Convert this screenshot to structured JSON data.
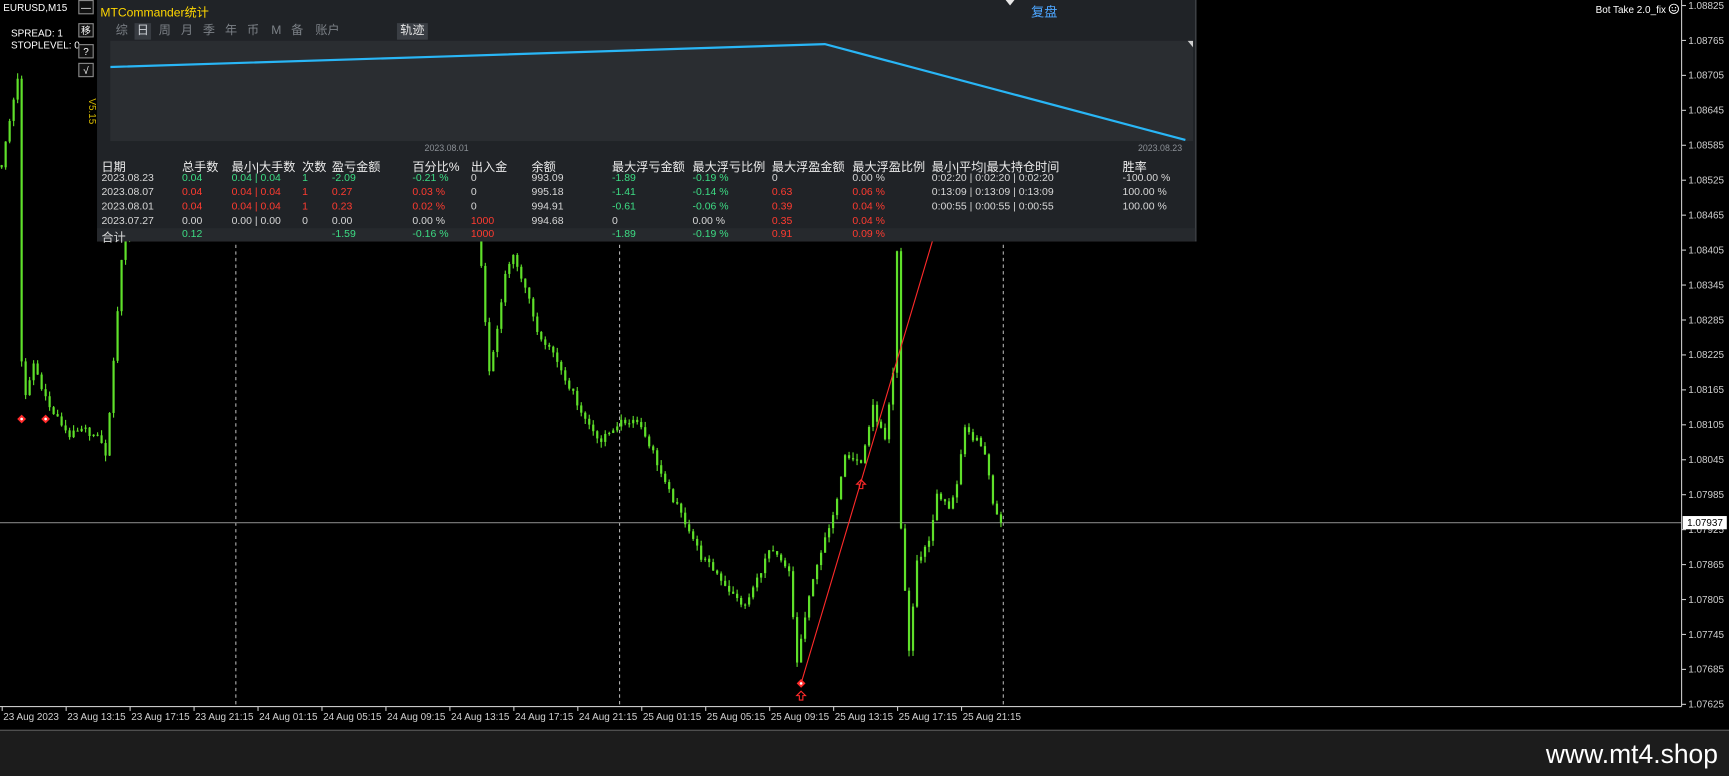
{
  "window": {
    "symbol_label": "EURUSD,M15",
    "spread": "SPREAD: 1",
    "stoplevel": "STOPLEVEL: 0",
    "version": "V5.15",
    "ea_name": "Bot Take 2.0_fix",
    "ea_icon": "smiley-icon",
    "watermark": "www.mt4.shop"
  },
  "side_buttons": {
    "minimize": "—",
    "move": "移",
    "help": "?",
    "check": "√"
  },
  "panel": {
    "title": "MTCommander统计",
    "replay": "复盘",
    "tabs": [
      "综",
      "日",
      "周",
      "月",
      "季",
      "年",
      "币",
      "M",
      "备",
      "账户"
    ],
    "active_tab": "日",
    "track_button": "轨迹",
    "track": {
      "date_labels": [
        "2023.08.01",
        "2023.08.23"
      ],
      "balance": [
        994.68,
        994.91,
        995.18,
        993.09
      ]
    },
    "table": {
      "headers": [
        "日期",
        "总手数",
        "最小|大手数",
        "次数",
        "盈亏金额",
        "百分比%",
        "出入金",
        "余额",
        "最大浮亏金额",
        "最大浮亏比例",
        "最大浮盈金额",
        "最大浮盈比例",
        "最小|平均|最大持仓时间",
        "胜率"
      ],
      "rows": [
        {
          "cells": [
            "2023.08.23",
            "0.04",
            "0.04 | 0.04",
            "1",
            "-2.09",
            "-0.21 %",
            "0",
            "993.09",
            "-1.89",
            "-0.19 %",
            "0",
            "0.00 %",
            "0:02:20 | 0:02:20 | 0:02:20",
            "-100.00 %"
          ],
          "tones": "wgggggwwggwwww"
        },
        {
          "cells": [
            "2023.08.07",
            "0.04",
            "0.04 | 0.04",
            "1",
            "0.27",
            "0.03 %",
            "0",
            "995.18",
            "-1.41",
            "-0.14 %",
            "0.63",
            "0.06 %",
            "0:13:09 | 0:13:09 | 0:13:09",
            "100.00 %"
          ],
          "tones": "wrrrrrwwggrrww"
        },
        {
          "cells": [
            "2023.08.01",
            "0.04",
            "0.04 | 0.04",
            "1",
            "0.23",
            "0.02 %",
            "0",
            "994.91",
            "-0.61",
            "-0.06 %",
            "0.39",
            "0.04 %",
            "0:00:55 | 0:00:55 | 0:00:55",
            "100.00 %"
          ],
          "tones": "wrrrrrwwggrrww"
        },
        {
          "cells": [
            "2023.07.27",
            "0.00",
            "0.00 | 0.00",
            "0",
            "0.00",
            "0.00 %",
            "1000",
            "994.68",
            "0",
            "0.00 %",
            "0.35",
            "0.04 %",
            "",
            ""
          ],
          "tones": "wwwwwwrwwwrrww"
        },
        {
          "cells": [
            "合计",
            "0.12",
            "",
            "",
            "-1.59",
            "-0.16 %",
            "1000",
            "",
            "-1.89",
            "-0.19 %",
            "0.91",
            "0.09 %",
            "",
            ""
          ],
          "tones": "wgwwggrwggrrww"
        }
      ]
    }
  },
  "colors": {
    "green": "#3ddc84",
    "red": "#ff3b30",
    "white": "#d6d6d6",
    "candle": "#5fe02a",
    "track_line": "#29b6f6",
    "trade": "#ff2a2a",
    "axis_text": "#d0d0d0",
    "price_line": "#808080",
    "separator": "#b0b0b0"
  },
  "chart_data": {
    "type": "candlestick",
    "symbol": "EURUSD",
    "timeframe": "M15",
    "price_labels": [
      "1.08825",
      "1.08765",
      "1.08705",
      "1.08645",
      "1.08585",
      "1.08525",
      "1.08465",
      "1.08405",
      "1.08345",
      "1.08285",
      "1.08225",
      "1.08165",
      "1.08105",
      "1.08045",
      "1.07985",
      "1.07925",
      "1.07865",
      "1.07805",
      "1.07745",
      "1.07685",
      "1.07625"
    ],
    "current_price": "1.07937",
    "time_labels": [
      "23 Aug 2023",
      "23 Aug 13:15",
      "23 Aug 17:15",
      "23 Aug 21:15",
      "24 Aug 01:15",
      "24 Aug 05:15",
      "24 Aug 09:15",
      "24 Aug 13:15",
      "24 Aug 17:15",
      "24 Aug 21:15",
      "25 Aug 01:15",
      "25 Aug 05:15",
      "25 Aug 09:15",
      "25 Aug 13:15",
      "25 Aug 17:15",
      "25 Aug 21:15"
    ],
    "day_separators": [
      "24 Aug 00:00",
      "25 Aug 00:00",
      "26 Aug 00:00"
    ],
    "close_path": [
      {
        "t": "23 Aug 09:15",
        "p": 1.08551
      },
      {
        "t": "23 Aug 09:45",
        "p": 1.08626
      },
      {
        "t": "23 Aug 10:15",
        "p": 1.08702
      },
      {
        "t": "23 Aug 10:30",
        "p": 1.0821
      },
      {
        "t": "23 Aug 10:45",
        "p": 1.08153
      },
      {
        "t": "23 Aug 11:15",
        "p": 1.0821
      },
      {
        "t": "23 Aug 12:15",
        "p": 1.08134
      },
      {
        "t": "23 Aug 13:30",
        "p": 1.08087
      },
      {
        "t": "23 Aug 14:30",
        "p": 1.08096
      },
      {
        "t": "23 Aug 15:30",
        "p": 1.08077
      },
      {
        "t": "23 Aug 15:45",
        "p": 1.08049
      },
      {
        "t": "23 Aug 16:15",
        "p": 1.0821
      },
      {
        "t": "23 Aug 16:30",
        "p": 1.08304
      },
      {
        "t": "23 Aug 16:45",
        "p": 1.0839
      },
      {
        "t": "23 Aug 17:15",
        "p": 1.08456
      },
      {
        "t": "23 Aug 21:45",
        "p": 1.0856
      },
      {
        "t": "24 Aug 02:45",
        "p": 1.086
      },
      {
        "t": "24 Aug 07:45",
        "p": 1.0854
      },
      {
        "t": "24 Aug 12:45",
        "p": 1.0852
      },
      {
        "t": "24 Aug 15:00",
        "p": 1.08456
      },
      {
        "t": "24 Aug 15:15",
        "p": 1.0838
      },
      {
        "t": "24 Aug 15:45",
        "p": 1.08191
      },
      {
        "t": "24 Aug 16:15",
        "p": 1.08267
      },
      {
        "t": "24 Aug 16:45",
        "p": 1.08361
      },
      {
        "t": "24 Aug 17:15",
        "p": 1.08399
      },
      {
        "t": "24 Aug 18:00",
        "p": 1.08342
      },
      {
        "t": "24 Aug 18:45",
        "p": 1.08267
      },
      {
        "t": "24 Aug 19:45",
        "p": 1.08229
      },
      {
        "t": "24 Aug 20:45",
        "p": 1.08172
      },
      {
        "t": "24 Aug 21:45",
        "p": 1.08115
      },
      {
        "t": "24 Aug 22:45",
        "p": 1.08077
      },
      {
        "t": "24 Aug 23:45",
        "p": 1.08106
      },
      {
        "t": "25 Aug 01:00",
        "p": 1.08115
      },
      {
        "t": "25 Aug 02:00",
        "p": 1.08058
      },
      {
        "t": "25 Aug 02:45",
        "p": 1.08002
      },
      {
        "t": "25 Aug 03:30",
        "p": 1.07964
      },
      {
        "t": "25 Aug 04:15",
        "p": 1.07926
      },
      {
        "t": "25 Aug 05:00",
        "p": 1.07878
      },
      {
        "t": "25 Aug 06:00",
        "p": 1.0785
      },
      {
        "t": "25 Aug 07:00",
        "p": 1.07812
      },
      {
        "t": "25 Aug 07:45",
        "p": 1.07793
      },
      {
        "t": "25 Aug 08:30",
        "p": 1.0784
      },
      {
        "t": "25 Aug 09:15",
        "p": 1.07888
      },
      {
        "t": "25 Aug 09:45",
        "p": 1.07878
      },
      {
        "t": "25 Aug 10:30",
        "p": 1.0785
      },
      {
        "t": "25 Aug 11:00",
        "p": 1.07698
      },
      {
        "t": "25 Aug 11:30",
        "p": 1.07774
      },
      {
        "t": "25 Aug 12:15",
        "p": 1.07869
      },
      {
        "t": "25 Aug 13:15",
        "p": 1.07945
      },
      {
        "t": "25 Aug 14:00",
        "p": 1.08058
      },
      {
        "t": "25 Aug 15:00",
        "p": 1.08039
      },
      {
        "t": "25 Aug 15:45",
        "p": 1.08134
      },
      {
        "t": "25 Aug 16:30",
        "p": 1.08077
      },
      {
        "t": "25 Aug 17:00",
        "p": 1.08191
      },
      {
        "t": "25 Aug 17:15",
        "p": 1.08399
      },
      {
        "t": "25 Aug 17:30",
        "p": 1.07926
      },
      {
        "t": "25 Aug 18:00",
        "p": 1.07717
      },
      {
        "t": "25 Aug 18:30",
        "p": 1.07869
      },
      {
        "t": "25 Aug 19:15",
        "p": 1.07907
      },
      {
        "t": "25 Aug 19:45",
        "p": 1.07983
      },
      {
        "t": "25 Aug 20:30",
        "p": 1.07964
      },
      {
        "t": "25 Aug 21:00",
        "p": 1.08002
      },
      {
        "t": "25 Aug 21:30",
        "p": 1.08096
      },
      {
        "t": "25 Aug 22:15",
        "p": 1.08077
      },
      {
        "t": "25 Aug 22:45",
        "p": 1.08058
      },
      {
        "t": "25 Aug 23:15",
        "p": 1.07973
      },
      {
        "t": "25 Aug 23:45",
        "p": 1.07937
      }
    ],
    "trade_line": {
      "from": {
        "t": "25 Aug 11:15",
        "p": 1.07661
      },
      "to": {
        "t": "25 Aug 19:45",
        "p": 1.08447
      }
    },
    "trade_marks": [
      {
        "kind": "diamond",
        "t": "23 Aug 10:30",
        "p": 1.08115
      },
      {
        "kind": "diamond",
        "t": "23 Aug 12:00",
        "p": 1.08115
      },
      {
        "kind": "diamond",
        "t": "25 Aug 11:15",
        "p": 1.07661
      },
      {
        "kind": "arrow-up",
        "t": "25 Aug 11:15",
        "p": 1.0764
      },
      {
        "kind": "arrow-up",
        "t": "25 Aug 15:00",
        "p": 1.08003
      }
    ]
  }
}
